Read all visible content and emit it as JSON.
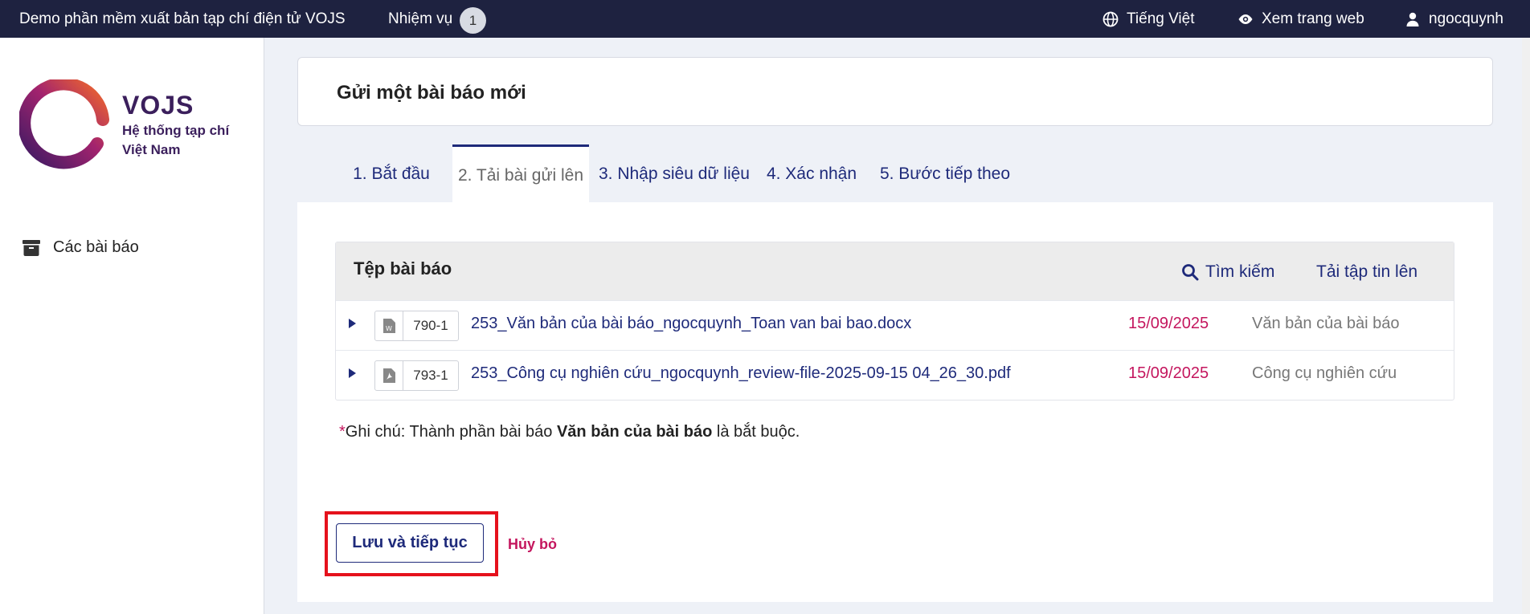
{
  "topbar": {
    "site_title": "Demo phần mềm xuất bản tạp chí điện tử VOJS",
    "tasks_label": "Nhiệm vụ",
    "tasks_count": "1",
    "language": "Tiếng Việt",
    "view_site": "Xem trang web",
    "user": "ngocquynh",
    "icons": [
      "globe-icon",
      "eye-icon",
      "user-icon"
    ],
    "background": "#1e2240"
  },
  "sidebar": {
    "logo": {
      "name": "VOJS",
      "subtitle_line1": "Hệ thống tạp chí",
      "subtitle_line2": "Việt Nam"
    },
    "items": [
      {
        "label": "Các bài báo",
        "icon": "archive-icon"
      }
    ]
  },
  "page": {
    "title": "Gửi một bài báo mới"
  },
  "tabs": [
    {
      "label": "1. Bắt đầu",
      "active": false
    },
    {
      "label": "2. Tải bài gửi lên",
      "active": true
    },
    {
      "label": "3. Nhập siêu dữ liệu",
      "active": false
    },
    {
      "label": "4. Xác nhận",
      "active": false
    },
    {
      "label": "5. Bước tiếp theo",
      "active": false
    }
  ],
  "files": {
    "title": "Tệp bài báo",
    "search_label": "Tìm kiếm",
    "upload_label": "Tải tập tin lên",
    "rows": [
      {
        "icon": "word-file-icon",
        "id": "790-1",
        "name": "253_Văn bản của bài báo_ngocquynh_Toan van bai bao.docx",
        "date": "15/09/2025",
        "type": "Văn bản của bài báo"
      },
      {
        "icon": "pdf-file-icon",
        "id": "793-1",
        "name": "253_Công cụ nghiên cứu_ngocquynh_review-file-2025-09-15 04_26_30.pdf",
        "date": "15/09/2025",
        "type": "Công cụ nghiên cứu"
      }
    ]
  },
  "note": {
    "star": "*",
    "prefix": "Ghi chú: Thành phần bài báo ",
    "bold": "Văn bản của bài báo",
    "suffix": " là bắt buộc."
  },
  "actions": {
    "save_label": "Lưu và tiếp tục",
    "cancel_label": "Hủy bỏ"
  },
  "colors": {
    "accent": "#1e2a7a",
    "date": "#c4165e",
    "highlight": "#e5111c"
  }
}
